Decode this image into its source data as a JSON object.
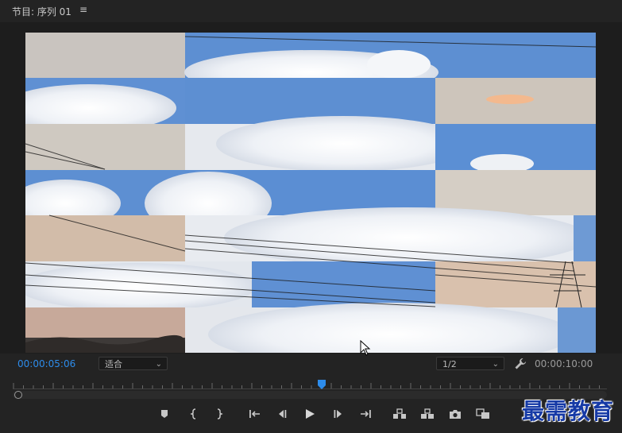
{
  "panel": {
    "title": "节目: 序列 01",
    "menu_icon": "hamburger-menu-icon"
  },
  "monitor": {
    "current_timecode": "00:00:05:06",
    "duration_timecode": "00:00:10:00",
    "zoom_select": {
      "selected": "适合"
    },
    "resolution_select": {
      "selected": "1/2"
    },
    "playhead_fraction": 0.52
  },
  "controls": {
    "icons": [
      "add-marker-icon",
      "mark-in-icon",
      "mark-out-icon",
      "go-to-in-icon",
      "step-back-icon",
      "play-icon",
      "step-forward-icon",
      "go-to-out-icon",
      "lift-icon",
      "extract-icon",
      "export-frame-icon",
      "comparison-view-icon"
    ]
  },
  "watermark": {
    "text": "最需教育"
  },
  "colors": {
    "timecode_accent": "#2d8ceb",
    "background": "#232323",
    "watermark": "#163aa6"
  }
}
